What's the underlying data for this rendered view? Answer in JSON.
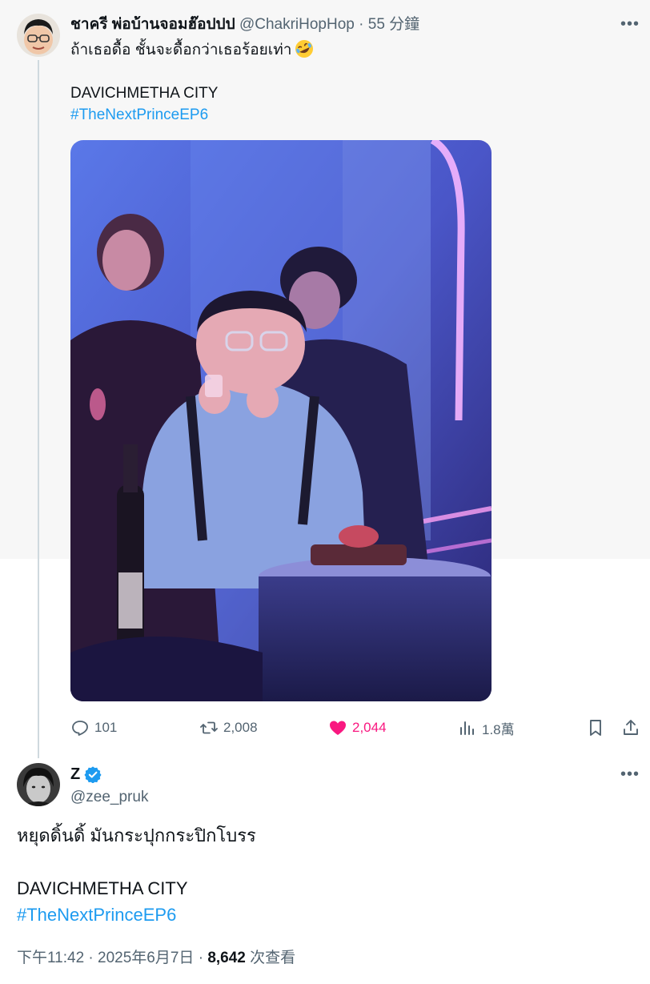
{
  "quoted_tweet": {
    "display_name": "ชาครี พ่อบ้านจอมฮ๊อปปป",
    "handle": "@ChakriHopHop",
    "separator": "·",
    "time": "55 分鐘",
    "text_line1": "ถ้าเธอดื้อ ชั้นจะดื้อกว่าเธอร้อยเท่า",
    "emoji": "rolling-on-floor-laughing-emoji",
    "text_line2": "DAVICHMETHA CITY",
    "hashtag": "#TheNextPrinceEP6",
    "stats": {
      "replies": "101",
      "retweets": "2,008",
      "likes": "2,044",
      "views": "1.8萬"
    }
  },
  "main_tweet": {
    "display_name": "Z",
    "handle": "@zee_pruk",
    "verified": true,
    "text_line1": "หยุดดิ้นดิ้ มันกระปุกกระปิกโบรร",
    "text_line2": "DAVICHMETHA CITY",
    "hashtag": "#TheNextPrinceEP6",
    "time": "下午11:42",
    "separator": "·",
    "date": "2025年6月7日",
    "views_count": "8,642",
    "views_label": "次查看"
  },
  "icons": [
    "more-icon",
    "reply-icon",
    "retweet-icon",
    "like-icon",
    "views-icon",
    "bookmark-icon",
    "share-icon",
    "verified-icon"
  ],
  "colors": {
    "accent": "#1d9bf0",
    "like": "#f91880",
    "secondary_text": "#536471",
    "primary_text": "#0f1419"
  }
}
